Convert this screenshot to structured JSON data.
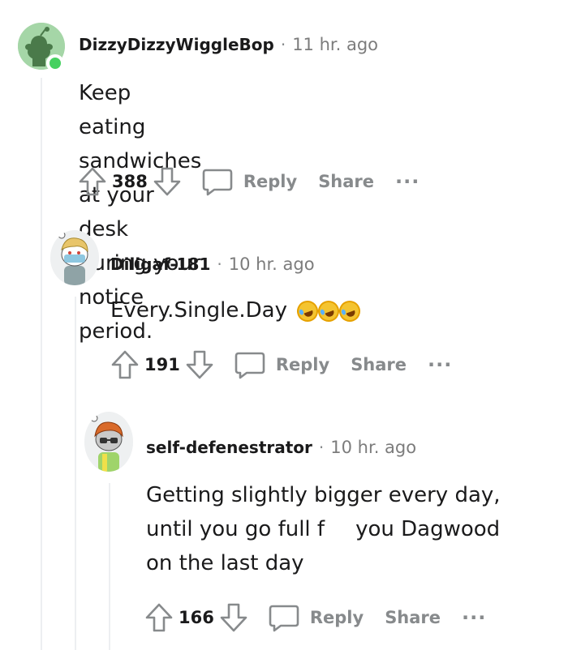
{
  "comments": [
    {
      "username": "DizzyDizzyWiggleBop",
      "separator": "·",
      "time": "11 hr. ago",
      "body": [
        "Keep eating sandwiches at your desk",
        "during your notice period."
      ],
      "score": "388",
      "reply_label": "Reply",
      "share_label": "Share",
      "more_label": "···",
      "avatar_color": "#a5d6a7",
      "online": true
    },
    {
      "username": "Diligaf-181",
      "separator": "·",
      "time": "10 hr. ago",
      "body_text": "Every.Single.Day",
      "emoji": [
        "rolling-on-floor-laughing",
        "rolling-on-floor-laughing",
        "rolling-on-floor-laughing"
      ],
      "score": "191",
      "reply_label": "Reply",
      "share_label": "Share",
      "more_label": "···"
    },
    {
      "username": "self-defenestrator",
      "separator": "·",
      "time": "10 hr. ago",
      "body_line1": "Getting slightly bigger every day,",
      "body_line2a": "until you go full f",
      "body_line2b": "you Dagwood",
      "body_line3": "on the last day",
      "score": "166",
      "reply_label": "Reply",
      "share_label": "Share",
      "more_label": "···"
    }
  ],
  "colors": {
    "text": "#1a1a1b",
    "muted": "#878a8c",
    "thread_line": "#edeff1",
    "online": "#46d160"
  }
}
